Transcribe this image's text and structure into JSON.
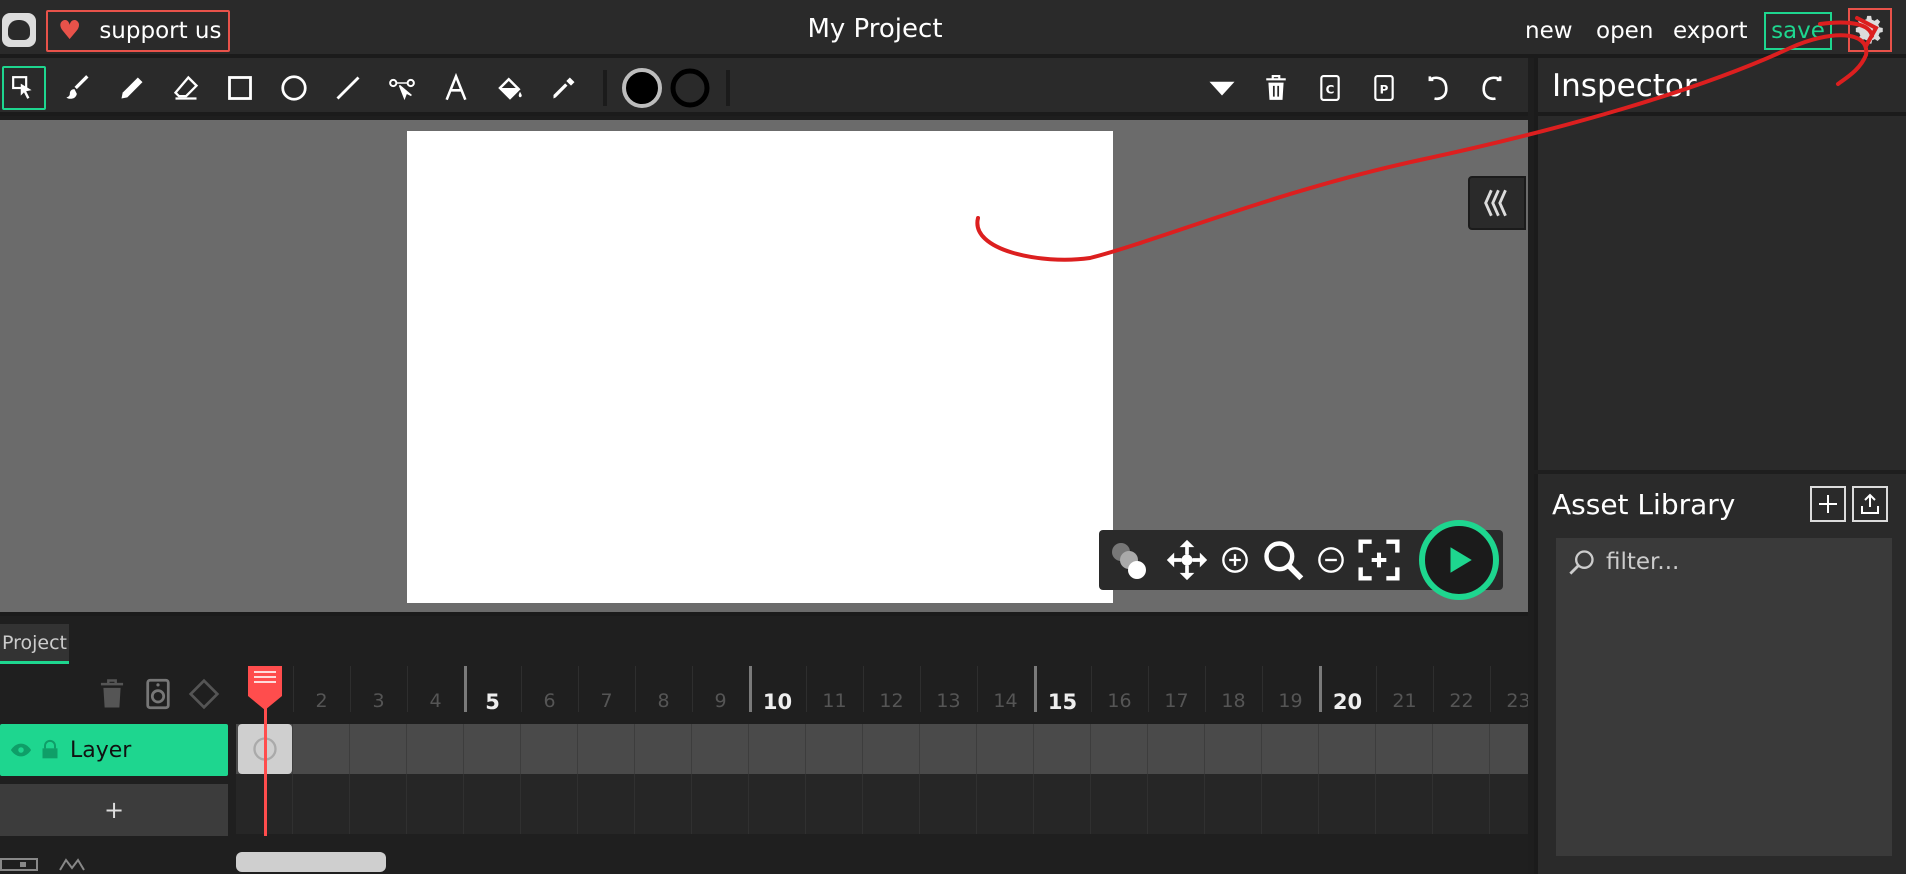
{
  "header": {
    "support_label": "support us",
    "project_title": "My Project",
    "menu": {
      "new": "new",
      "open": "open",
      "export": "export",
      "save": "save"
    }
  },
  "toolbar": {
    "tools": [
      "cursor",
      "brush",
      "pencil",
      "eraser",
      "rectangle",
      "ellipse",
      "line",
      "path",
      "text",
      "fill",
      "eyedropper"
    ],
    "colors": {
      "fill": "#000000",
      "stroke": "#000000"
    }
  },
  "inspector": {
    "title": "Inspector"
  },
  "assets": {
    "title": "Asset Library",
    "filter_placeholder": "filter..."
  },
  "timeline": {
    "tab_label": "Project",
    "layer_name": "Layer",
    "add_label": "+",
    "frame_numbers": [
      "2",
      "3",
      "4",
      "5",
      "6",
      "7",
      "8",
      "9",
      "10",
      "11",
      "12",
      "13",
      "14",
      "15",
      "16",
      "17",
      "18",
      "19",
      "20",
      "21",
      "22",
      "23"
    ],
    "current_frame": 1
  },
  "colors": {
    "accent": "#1ed68f",
    "danger": "#e8524a",
    "playhead": "#ff4d4d"
  }
}
